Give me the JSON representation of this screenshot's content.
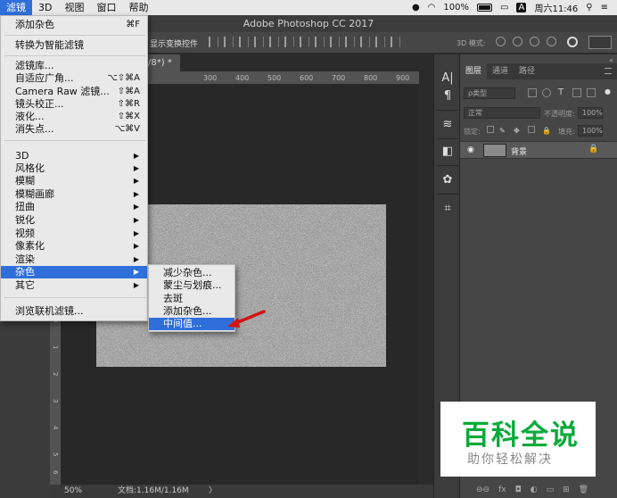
{
  "menubar": {
    "items": [
      "滤镜",
      "3D",
      "视图",
      "窗口",
      "帮助"
    ],
    "battery": "100%",
    "clock": "周六11:46",
    "a_icon": "A"
  },
  "app": {
    "title": "Adobe Photoshop CC 2017"
  },
  "options_bar": {
    "show_transform": "显示变换控件",
    "mode_3d": "3D 模式:"
  },
  "document": {
    "tab_label": "/8*) *",
    "ruler_ticks": [
      "300",
      "400",
      "500",
      "600",
      "700",
      "800",
      "900"
    ],
    "ruler_left_ticks": [
      "0",
      "1",
      "2",
      "3",
      "4",
      "5",
      "6",
      "7"
    ]
  },
  "status": {
    "zoom": "50%",
    "doc_size": "文档:1.16M/1.16M",
    "arrow": "〉"
  },
  "filter_menu": {
    "items": [
      {
        "label": "添加杂色",
        "shortcut": "⌘F"
      },
      {
        "label": "转换为智能滤镜",
        "shortcut": ""
      },
      {
        "label": "滤镜库...",
        "shortcut": ""
      },
      {
        "label": "自适应广角...",
        "shortcut": "⌥⇧⌘A"
      },
      {
        "label": "Camera Raw 滤镜...",
        "shortcut": "⇧⌘A"
      },
      {
        "label": "镜头校正...",
        "shortcut": "⇧⌘R"
      },
      {
        "label": "液化...",
        "shortcut": "⇧⌘X"
      },
      {
        "label": "消失点...",
        "shortcut": "⌥⌘V"
      },
      {
        "label": "3D",
        "shortcut": "▶"
      },
      {
        "label": "风格化",
        "shortcut": "▶"
      },
      {
        "label": "模糊",
        "shortcut": "▶"
      },
      {
        "label": "模糊画廊",
        "shortcut": "▶"
      },
      {
        "label": "扭曲",
        "shortcut": "▶"
      },
      {
        "label": "锐化",
        "shortcut": "▶"
      },
      {
        "label": "视频",
        "shortcut": "▶"
      },
      {
        "label": "像素化",
        "shortcut": "▶"
      },
      {
        "label": "渲染",
        "shortcut": "▶"
      },
      {
        "label": "杂色",
        "shortcut": "▶"
      },
      {
        "label": "其它",
        "shortcut": "▶"
      },
      {
        "label": "浏览联机滤镜...",
        "shortcut": ""
      }
    ]
  },
  "noise_submenu": {
    "items": [
      "减少杂色...",
      "蒙尘与划痕...",
      "去斑",
      "添加杂色...",
      "中间值..."
    ]
  },
  "layers_panel": {
    "tabs": [
      "图层",
      "通道",
      "路径"
    ],
    "filter_kind": "ρ类型",
    "blend_mode": "正常",
    "opacity_label": "不透明度:",
    "opacity_value": "100%",
    "lock_label": "锁定:",
    "fill_label": "填充:",
    "fill_value": "100%",
    "layer_name": "背景",
    "collapse": "«",
    "footer": [
      "⊖⊖",
      "fx",
      "◘",
      "◐",
      "▭",
      "⊞",
      "🗑"
    ]
  },
  "watermark": {
    "title": "百科全说",
    "subtitle": "助你轻松解决"
  },
  "colors": {
    "menu_highlight": "#2f6fdb",
    "watermark_green": "#0aaa3a",
    "arrow_red": "#d21414"
  }
}
